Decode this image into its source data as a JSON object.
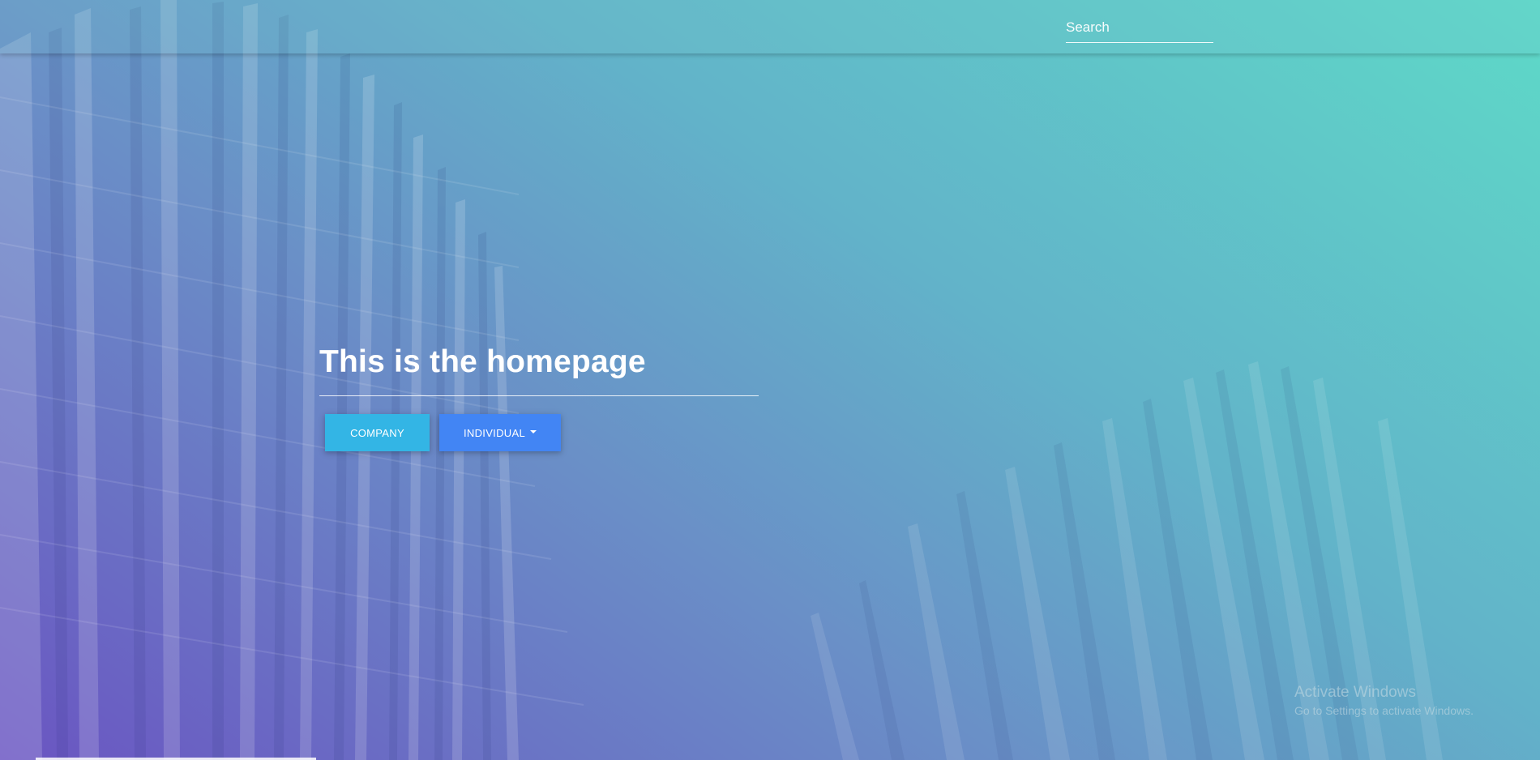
{
  "navbar": {
    "search": {
      "placeholder": "Search",
      "value": ""
    }
  },
  "hero": {
    "title": "This is the homepage",
    "buttons": {
      "company_label": "COMPANY",
      "individual_label": "INDIVIDUAL"
    }
  },
  "watermark": {
    "title": "Activate Windows",
    "subtitle": "Go to Settings to activate Windows."
  },
  "icons": {
    "individual_dropdown": "caret-down-icon"
  },
  "colors": {
    "company_button": "#33b5e5",
    "individual_button": "#4285f4",
    "gradient_start": "#6a55c2",
    "gradient_end": "#5ed9c8"
  }
}
